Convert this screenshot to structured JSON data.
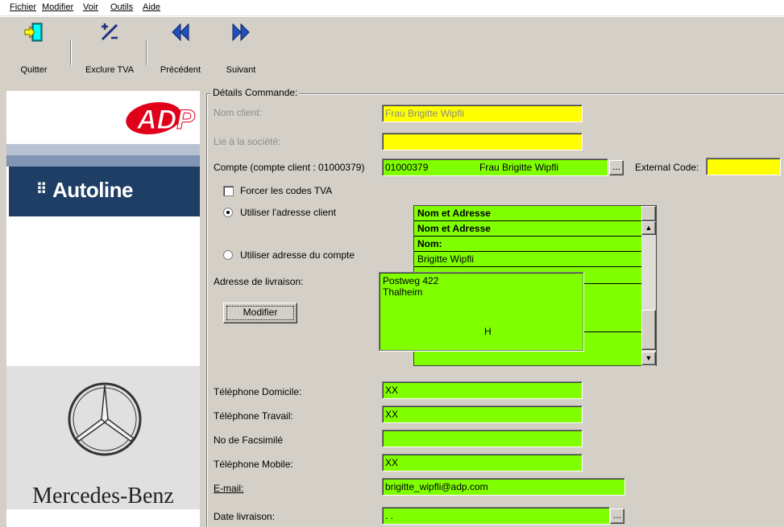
{
  "menu": [
    "Fichier",
    "Modifier",
    "Voir",
    "Outils",
    "Aide"
  ],
  "toolbar": {
    "quit": "Quitter",
    "exclude_vat": "Exclure TVA",
    "previous": "Précédent",
    "next": "Suivant"
  },
  "branding": {
    "adp": "ADP",
    "autoline": "Autoline",
    "mercedes": "Mercedes-Benz"
  },
  "group_title": "Détails Commande:",
  "fields": {
    "client_name_label": "Nom client:",
    "client_name_value": "Frau Brigitte Wipfli",
    "company_label": "Lié à la société:",
    "company_value": "",
    "account_label": "Compte (compte client : 01000379)",
    "account_value": "01000379",
    "account_name": "Frau Brigitte Wipfli",
    "external_code_label": "External Code:",
    "external_code_value": "",
    "force_vat_label": "Forcer les codes TVA",
    "use_client_address_label": "Utiliser l'adresse client",
    "use_account_address_label": "Utiliser adresse du compte",
    "delivery_address_label": "Adresse de livraison:",
    "modify_button": "Modifier",
    "address_line1": "Postweg 422",
    "address_line2": "Thalheim",
    "address_extra": "H",
    "home_phone_label": "Téléphone Domicile:",
    "home_phone_value": "XX",
    "work_phone_label": "Téléphone Travail:",
    "work_phone_value": "XX",
    "fax_label": "No de Facsimilé",
    "fax_value": "",
    "mobile_label": "Téléphone Mobile:",
    "mobile_value": "XX",
    "email_label": "E-mail:",
    "email_value": "brigitte_wipfli@adp.com",
    "delivery_date_label": "Date livraison:",
    "delivery_date_value": ". .",
    "ellipsis": "..."
  },
  "address_grid": {
    "rows": [
      "Nom et Adresse",
      "Nom et Adresse",
      "Nom:",
      "Brigitte  Wipfli"
    ]
  },
  "colors": {
    "yellow": "#ffff00",
    "green": "#80ff00",
    "autoline_blue": "#1e3e66",
    "adp_red": "#e0001a"
  }
}
